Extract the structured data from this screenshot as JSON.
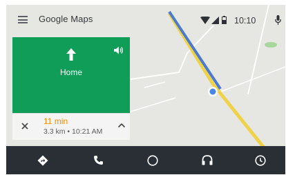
{
  "header": {
    "title": "Google Maps",
    "time": "10:10"
  },
  "navigation": {
    "destination": "Home",
    "maneuver_icon": "arrow-up-icon",
    "sound_icon": "volume-icon"
  },
  "trip": {
    "duration": "11 min",
    "detail": "3.3 km • 10:21 AM"
  },
  "dock": {
    "items": [
      {
        "name": "navigation",
        "icon": "navigation-icon"
      },
      {
        "name": "phone",
        "icon": "phone-icon"
      },
      {
        "name": "home",
        "icon": "home-circle-icon"
      },
      {
        "name": "music",
        "icon": "headphones-icon"
      },
      {
        "name": "overview",
        "icon": "clock-icon"
      }
    ]
  },
  "colors": {
    "nav_green": "#0f9d58",
    "route_blue": "#4a7bd0",
    "road_yellow": "#f0d24a",
    "eta_orange": "#f58b00",
    "dock": "#2a2f36"
  }
}
